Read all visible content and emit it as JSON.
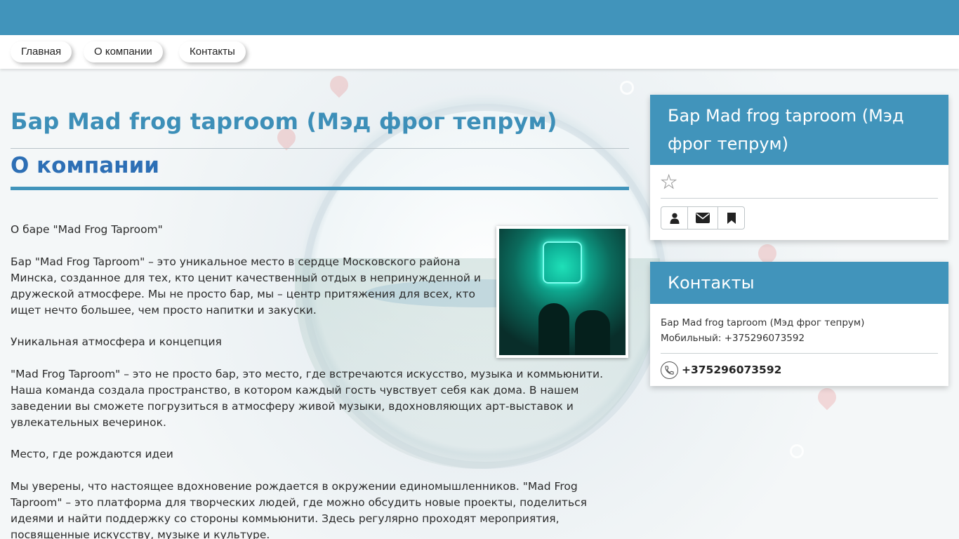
{
  "nav": {
    "items": [
      {
        "label": "Главная"
      },
      {
        "label": "О компании"
      },
      {
        "label": "Контакты"
      }
    ]
  },
  "main": {
    "title": "Бар Mad frog taproom (Мэд фрог тепрум)",
    "section_title": "О компании",
    "paragraphs": [
      "О баре \"Mad Frog Taproom\"",
      "Бар \"Mad Frog Taproom\" – это уникальное место в сердце Московского района Минска, созданное для тех, кто ценит качественный отдых в непринужденной и дружеской атмосфере. Мы не просто бар, мы – центр притяжения для всех, кто ищет нечто большее, чем просто напитки и закуски.",
      "Уникальная атмосфера и концепция",
      "\"Mad Frog Taproom\" – это не просто бар, это место, где встречаются искусство, музыка и коммьюнити. Наша команда создала пространство, в котором каждый гость чувствует себя как дома. В нашем заведении вы сможете погрузиться в атмосферу живой музыки, вдохновляющих арт-выставок и увлекательных вечеринок.",
      "Место, где рождаются идеи",
      "Мы уверены, что настоящее вдохновение рождается в окружении единомышленников. \"Mad Frog Taproom\" – это платформа для творческих людей, где можно обсудить новые проекты, поделиться идеями и найти поддержку со стороны коммьюнити. Здесь регулярно проходят мероприятия, посвященные искусству, музыке и культуре."
    ]
  },
  "sidebar": {
    "profile": {
      "title": "Бар Mad frog taproom (Мэд фрог тепрум)",
      "rating_icon": "star-outline-icon",
      "buttons": [
        {
          "icon": "user-icon"
        },
        {
          "icon": "envelope-icon"
        },
        {
          "icon": "bookmark-icon"
        }
      ]
    },
    "contacts": {
      "title": "Контакты",
      "name": "Бар Mad frog taproom (Мэд фрог тепрум)",
      "mobile": "Мобильный: +375296073592",
      "phone": "+375296073592"
    }
  },
  "colors": {
    "accent": "#4194bb",
    "title": "#3d8fb8",
    "section": "#2d6fb5"
  }
}
